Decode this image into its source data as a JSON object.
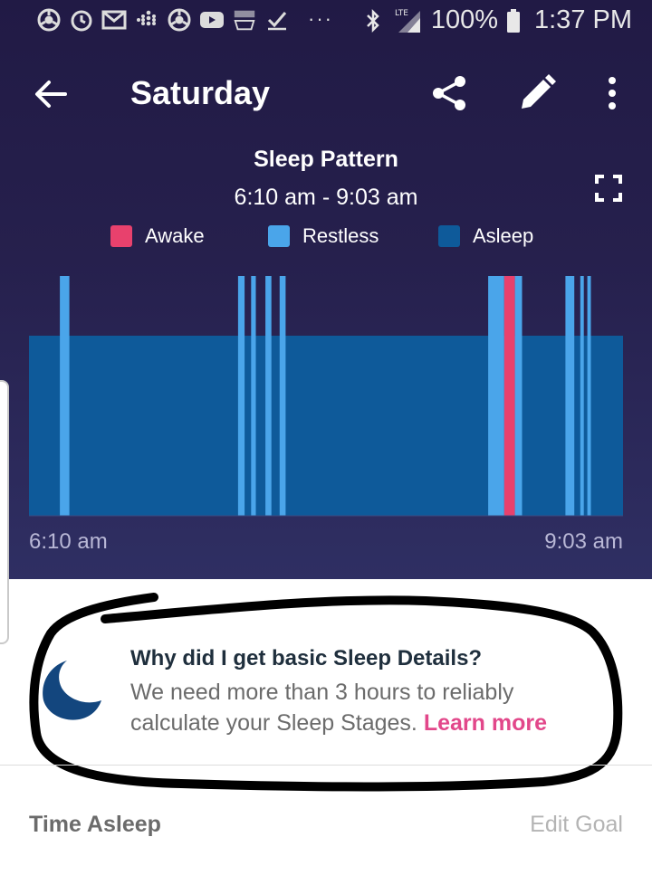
{
  "status_bar": {
    "battery_text": "100%",
    "time": "1:37 PM",
    "network": "LTE",
    "left_icons": [
      "chrome-icon",
      "timer-icon",
      "gmail-icon",
      "fitbit-icon",
      "chrome-icon",
      "youtube-icon",
      "amazon-icon",
      "check-icon"
    ],
    "right_icons": [
      "bluetooth-icon",
      "signal-icon",
      "battery-icon"
    ]
  },
  "app_bar": {
    "title": "Saturday",
    "icons": [
      "back-arrow-icon",
      "share-icon",
      "edit-pencil-icon",
      "more-vert-icon"
    ]
  },
  "chart": {
    "title": "Sleep Pattern",
    "range": "6:10 am - 9:03 am",
    "legend": [
      {
        "label": "Awake",
        "color": "#e8416d"
      },
      {
        "label": "Restless",
        "color": "#4aa5ea"
      },
      {
        "label": "Asleep",
        "color": "#0e5a9a"
      }
    ],
    "start_label": "6:10 am",
    "end_label": "9:03 am"
  },
  "chart_data": {
    "type": "bar",
    "x_range": [
      "6:10 am",
      "9:03 am"
    ],
    "base_state": "Asleep",
    "segments": [
      {
        "state": "Restless",
        "start": 0.052,
        "end": 0.068
      },
      {
        "state": "Restless",
        "start": 0.352,
        "end": 0.363
      },
      {
        "state": "Restless",
        "start": 0.374,
        "end": 0.382
      },
      {
        "state": "Restless",
        "start": 0.398,
        "end": 0.408
      },
      {
        "state": "Restless",
        "start": 0.422,
        "end": 0.432
      },
      {
        "state": "Restless",
        "start": 0.773,
        "end": 0.8
      },
      {
        "state": "Awake",
        "start": 0.8,
        "end": 0.818
      },
      {
        "state": "Restless",
        "start": 0.818,
        "end": 0.83
      },
      {
        "state": "Restless",
        "start": 0.903,
        "end": 0.918
      },
      {
        "state": "Restless",
        "start": 0.928,
        "end": 0.934
      },
      {
        "state": "Restless",
        "start": 0.94,
        "end": 0.946
      }
    ]
  },
  "info": {
    "title": "Why did I get basic Sleep Details?",
    "body": "We need more than 3 hours to reliably calculate your Sleep Stages.",
    "link": "Learn more"
  },
  "footer": {
    "label": "Time Asleep",
    "action": "Edit Goal"
  },
  "colors": {
    "hero_bg": "#231c48",
    "accent_pink": "#e2478a",
    "awake": "#e8416d",
    "restless": "#4aa5ea",
    "asleep": "#0e5a9a"
  }
}
